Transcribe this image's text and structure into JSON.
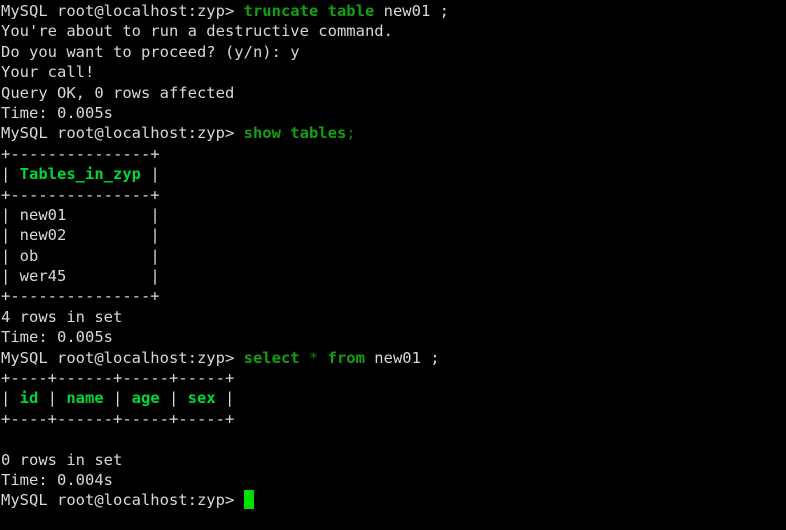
{
  "terminal": {
    "app": "MySQL client",
    "prompt": "MySQL root@localhost:zyp> ",
    "colors": {
      "background": "#000000",
      "foreground": "#d8d8d8",
      "keyword": "#12a012",
      "punctuation": "#0f7a0f",
      "table_header": "#00d838",
      "cursor": "#00e000"
    },
    "lines": [
      {
        "name": "command-truncate",
        "segments": [
          {
            "style": "prompt",
            "text": "MySQL root@localhost:zyp> "
          },
          {
            "style": "kw",
            "text": "truncate table"
          },
          {
            "style": "plain",
            "text": " new01 ;"
          }
        ]
      },
      {
        "name": "warning-destructive-1",
        "segments": [
          {
            "style": "plain",
            "text": "You're about to run a destructive command."
          }
        ]
      },
      {
        "name": "confirm-prompt",
        "segments": [
          {
            "style": "plain",
            "text": "Do you want to proceed? (y/n): y"
          }
        ]
      },
      {
        "name": "your-call-message",
        "segments": [
          {
            "style": "plain",
            "text": "Your call!"
          }
        ]
      },
      {
        "name": "query-ok-truncate",
        "segments": [
          {
            "style": "plain",
            "text": "Query OK, 0 rows affected"
          }
        ]
      },
      {
        "name": "time-truncate",
        "segments": [
          {
            "style": "plain",
            "text": "Time: 0.005s"
          }
        ]
      },
      {
        "name": "command-show-tables",
        "segments": [
          {
            "style": "prompt",
            "text": "MySQL root@localhost:zyp> "
          },
          {
            "style": "kw",
            "text": "show tables"
          },
          {
            "style": "punct",
            "text": ";"
          }
        ]
      },
      {
        "name": "tables-border-top",
        "segments": [
          {
            "style": "border",
            "text": "+---------------+"
          }
        ]
      },
      {
        "name": "tables-header-row",
        "segments": [
          {
            "style": "border",
            "text": "| "
          },
          {
            "style": "hdr",
            "text": "Tables_in_zyp"
          },
          {
            "style": "border",
            "text": " |"
          }
        ]
      },
      {
        "name": "tables-border-mid",
        "segments": [
          {
            "style": "border",
            "text": "+---------------+"
          }
        ]
      },
      {
        "name": "tables-row-new01",
        "segments": [
          {
            "style": "border",
            "text": "| "
          },
          {
            "style": "plain",
            "text": "new01        "
          },
          {
            "style": "border",
            "text": " |"
          }
        ]
      },
      {
        "name": "tables-row-new02",
        "segments": [
          {
            "style": "border",
            "text": "| "
          },
          {
            "style": "plain",
            "text": "new02        "
          },
          {
            "style": "border",
            "text": " |"
          }
        ]
      },
      {
        "name": "tables-row-ob",
        "segments": [
          {
            "style": "border",
            "text": "| "
          },
          {
            "style": "plain",
            "text": "ob           "
          },
          {
            "style": "border",
            "text": " |"
          }
        ]
      },
      {
        "name": "tables-row-wer45",
        "segments": [
          {
            "style": "border",
            "text": "| "
          },
          {
            "style": "plain",
            "text": "wer45        "
          },
          {
            "style": "border",
            "text": " |"
          }
        ]
      },
      {
        "name": "tables-border-bottom",
        "segments": [
          {
            "style": "border",
            "text": "+---------------+"
          }
        ]
      },
      {
        "name": "rowcount-show-tables",
        "segments": [
          {
            "style": "plain",
            "text": "4 rows in set"
          }
        ]
      },
      {
        "name": "time-show-tables",
        "segments": [
          {
            "style": "plain",
            "text": "Time: 0.005s"
          }
        ]
      },
      {
        "name": "command-select",
        "segments": [
          {
            "style": "prompt",
            "text": "MySQL root@localhost:zyp> "
          },
          {
            "style": "kw",
            "text": "select"
          },
          {
            "style": "punct",
            "text": " * "
          },
          {
            "style": "kw",
            "text": "from"
          },
          {
            "style": "plain",
            "text": " new01 ;"
          }
        ]
      },
      {
        "name": "select-border-top",
        "segments": [
          {
            "style": "border",
            "text": "+----+------+-----+-----+"
          }
        ]
      },
      {
        "name": "select-header-row",
        "segments": [
          {
            "style": "border",
            "text": "| "
          },
          {
            "style": "hdr",
            "text": "id"
          },
          {
            "style": "border",
            "text": " | "
          },
          {
            "style": "hdr",
            "text": "name"
          },
          {
            "style": "border",
            "text": " | "
          },
          {
            "style": "hdr",
            "text": "age"
          },
          {
            "style": "border",
            "text": " | "
          },
          {
            "style": "hdr",
            "text": "sex"
          },
          {
            "style": "border",
            "text": " |"
          }
        ]
      },
      {
        "name": "select-border-bottom",
        "segments": [
          {
            "style": "border",
            "text": "+----+------+-----+-----+"
          }
        ]
      },
      {
        "name": "blank-line",
        "segments": [
          {
            "style": "plain",
            "text": ""
          }
        ]
      },
      {
        "name": "rowcount-select",
        "segments": [
          {
            "style": "plain",
            "text": "0 rows in set"
          }
        ]
      },
      {
        "name": "time-select",
        "segments": [
          {
            "style": "plain",
            "text": "Time: 0.004s"
          }
        ]
      },
      {
        "name": "active-prompt-line",
        "segments": [
          {
            "style": "prompt",
            "text": "MySQL root@localhost:zyp> "
          },
          {
            "style": "cursor",
            "text": ""
          }
        ]
      }
    ]
  }
}
